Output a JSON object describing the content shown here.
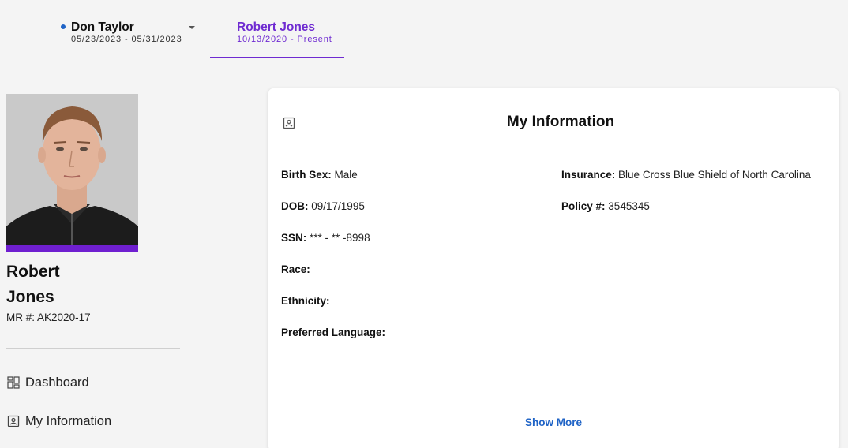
{
  "tabs": [
    {
      "name": "Don Taylor",
      "dates": "05/23/2023 - 05/31/2023",
      "active": false
    },
    {
      "name": "Robert Jones",
      "dates": "10/13/2020 - Present",
      "active": true
    }
  ],
  "profile": {
    "first_name": "Robert",
    "last_name": "Jones",
    "mr_label": "MR #:",
    "mr_value": "AK2020-17"
  },
  "nav": [
    {
      "label": "Dashboard",
      "icon": "dashboard-icon"
    },
    {
      "label": "My Information",
      "icon": "contact-card-icon"
    }
  ],
  "card": {
    "title": "My Information",
    "icon": "contact-card-icon",
    "fields_left": [
      {
        "label": "Birth Sex:",
        "value": "Male"
      },
      {
        "label": "DOB:",
        "value": "09/17/1995"
      },
      {
        "label": "SSN:",
        "value": "*** - ** -8998"
      },
      {
        "label": "Race:",
        "value": ""
      },
      {
        "label": "Ethnicity:",
        "value": ""
      },
      {
        "label": "Preferred Language:",
        "value": ""
      }
    ],
    "fields_right": [
      {
        "label": "Insurance:",
        "value": "Blue Cross Blue Shield of North Carolina"
      },
      {
        "label": "Policy #:",
        "value": "3545345"
      }
    ],
    "show_more": "Show More"
  },
  "colors": {
    "accent_purple": "#6f2bd1",
    "link_blue": "#1f63c6",
    "page_bg": "#f4f4f4"
  }
}
